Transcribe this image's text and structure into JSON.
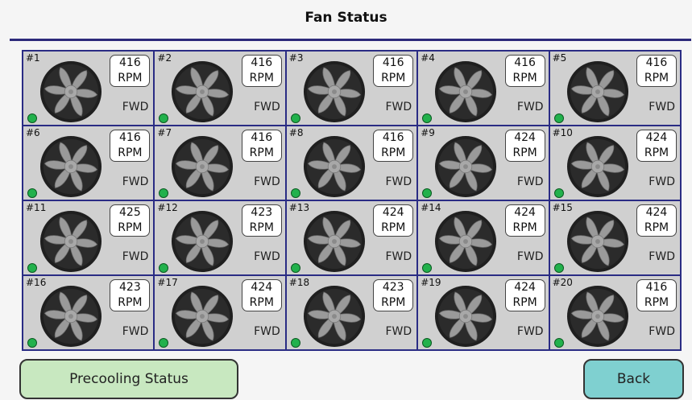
{
  "header": {
    "title": "Fan Status"
  },
  "rpm_unit": "RPM",
  "fans": [
    {
      "label": "#1",
      "rpm": "416",
      "direction": "FWD"
    },
    {
      "label": "#2",
      "rpm": "416",
      "direction": "FWD"
    },
    {
      "label": "#3",
      "rpm": "416",
      "direction": "FWD"
    },
    {
      "label": "#4",
      "rpm": "416",
      "direction": "FWD"
    },
    {
      "label": "#5",
      "rpm": "416",
      "direction": "FWD"
    },
    {
      "label": "#6",
      "rpm": "416",
      "direction": "FWD"
    },
    {
      "label": "#7",
      "rpm": "416",
      "direction": "FWD"
    },
    {
      "label": "#8",
      "rpm": "416",
      "direction": "FWD"
    },
    {
      "label": "#9",
      "rpm": "424",
      "direction": "FWD"
    },
    {
      "label": "#10",
      "rpm": "424",
      "direction": "FWD"
    },
    {
      "label": "#11",
      "rpm": "425",
      "direction": "FWD"
    },
    {
      "label": "#12",
      "rpm": "423",
      "direction": "FWD"
    },
    {
      "label": "#13",
      "rpm": "424",
      "direction": "FWD"
    },
    {
      "label": "#14",
      "rpm": "424",
      "direction": "FWD"
    },
    {
      "label": "#15",
      "rpm": "424",
      "direction": "FWD"
    },
    {
      "label": "#16",
      "rpm": "423",
      "direction": "FWD"
    },
    {
      "label": "#17",
      "rpm": "424",
      "direction": "FWD"
    },
    {
      "label": "#18",
      "rpm": "423",
      "direction": "FWD"
    },
    {
      "label": "#19",
      "rpm": "424",
      "direction": "FWD"
    },
    {
      "label": "#20",
      "rpm": "416",
      "direction": "FWD"
    }
  ],
  "buttons": {
    "precooling_label": "Precooling Status",
    "back_label": "Back"
  },
  "colors": {
    "header_rule": "#2d2a7a",
    "grid_lines": "#2a2c84",
    "cell_bg": "#d0d0d0",
    "status_ok": "#22b14c",
    "precooling_button": "#c8e8c0",
    "back_button": "#7fd0d0"
  },
  "icons": {
    "fan": "fan-icon",
    "status": "status-led-icon"
  }
}
